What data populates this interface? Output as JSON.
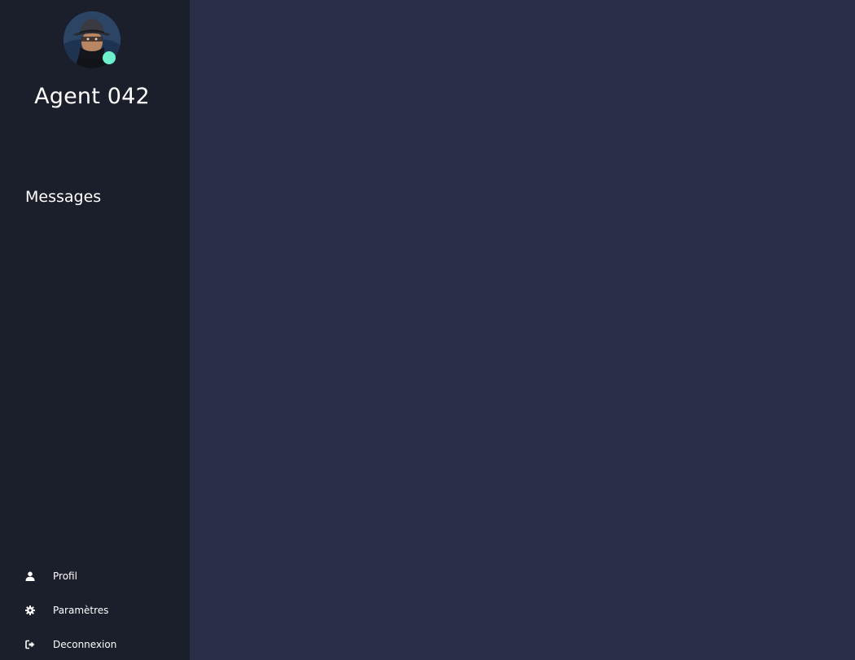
{
  "user": {
    "name": "Agent 042",
    "avatar_icon": "spy-avatar",
    "status_color": "#6ff0cc"
  },
  "sidebar": {
    "section_title": "Messages",
    "menu": [
      {
        "label": "Profil",
        "icon": "user-icon"
      },
      {
        "label": "Paramètres",
        "icon": "gear-icon"
      },
      {
        "label": "Deconnexion",
        "icon": "sign-out-icon"
      }
    ]
  },
  "colors": {
    "sidebar_bg": "#1b1e2b",
    "main_bg": "#2a2e48",
    "online": "#6ff0cc"
  }
}
